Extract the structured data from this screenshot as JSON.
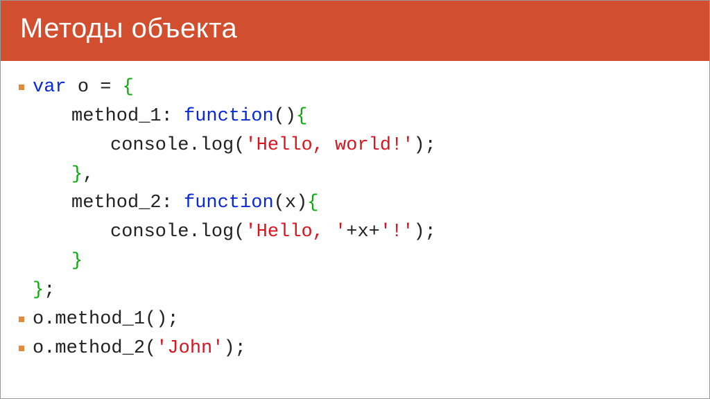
{
  "header": {
    "title": "Методы объекта"
  },
  "code": {
    "kw_var": "var",
    "obj_name": "o",
    "assign": " = ",
    "brace_open": "{",
    "brace_close": "}",
    "brace_close_semi": "};",
    "brace_close_comma": "},",
    "prop1": "method_1",
    "prop2": "method_2",
    "colon_sp": ": ",
    "kw_function": "function",
    "paren_open": "(",
    "paren_close": ")",
    "paren_empty_open_brace": "(){",
    "param_x": "x",
    "paren_close_brace": "){",
    "console": "console",
    "dot": ".",
    "log": "log",
    "str_hello_world": "'Hello, world!'",
    "str_hello_sp": "'Hello, '",
    "plus": "+",
    "x": "x",
    "str_bang": "'!'",
    "paren_close_semi": ");",
    "call1": "o.method_1();",
    "call2_pre": "o.method_2(",
    "call2_arg": "'John'",
    "call2_post": ");"
  }
}
